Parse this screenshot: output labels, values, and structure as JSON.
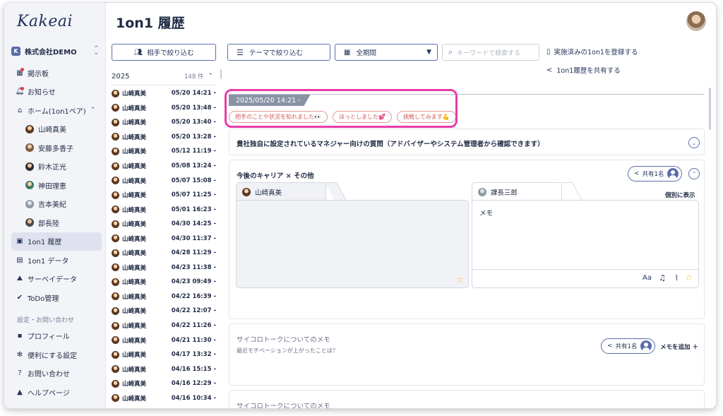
{
  "app": {
    "logo": "Kakeai",
    "company": "株式会社DEMO"
  },
  "sidebar": {
    "items": [
      {
        "label": "掲示板",
        "icon": "grid-icon"
      },
      {
        "label": "お知らせ",
        "icon": "bell-icon"
      },
      {
        "label": "ホーム(1on1ペア)",
        "icon": "home-icon",
        "caret": "⌃"
      }
    ],
    "members": [
      "山崎真美",
      "安藤多香子",
      "鈴木正光",
      "神田理恵",
      "吉本美紀",
      "部長陸"
    ],
    "items2": [
      {
        "label": "1on1 履歴",
        "icon": "history-icon",
        "active": true
      },
      {
        "label": "1on1 データ",
        "icon": "chart-icon"
      },
      {
        "label": "サーベイデータ",
        "icon": "survey-icon"
      },
      {
        "label": "ToDo管理",
        "icon": "check-icon"
      }
    ],
    "section_label": "設定・お問い合わせ",
    "items3": [
      {
        "label": "プロフィール",
        "icon": "profile-icon"
      },
      {
        "label": "便利にする設定",
        "icon": "gear-icon"
      },
      {
        "label": "お問い合わせ",
        "icon": "question-icon"
      },
      {
        "label": "ヘルプページ",
        "icon": "help-icon"
      }
    ]
  },
  "header": {
    "title": "1on1 履歴"
  },
  "toolbar": {
    "filter_person": "相手で絞り込む",
    "filter_theme": "テーマで絞り込む",
    "period": "全期間",
    "search_placeholder": "キーワードで検索する",
    "register": "実施済みの1on1を登録する",
    "share_history": "1on1履歴を共有する"
  },
  "list": {
    "year": "2025",
    "count": "148 件",
    "rows": [
      {
        "name": "山崎真美",
        "date": "05/20 14:21 -"
      },
      {
        "name": "山崎真美",
        "date": "05/20 13:48 -"
      },
      {
        "name": "山崎真美",
        "date": "05/20 13:40 -"
      },
      {
        "name": "山崎真美",
        "date": "05/20 13:28 -"
      },
      {
        "name": "山崎真美",
        "date": "05/12 11:19 -"
      },
      {
        "name": "山崎真美",
        "date": "05/08 13:24 -"
      },
      {
        "name": "山崎真美",
        "date": "05/07 15:08 -"
      },
      {
        "name": "山崎真美",
        "date": "05/07 11:25 -"
      },
      {
        "name": "山崎真美",
        "date": "05/01 16:23 -"
      },
      {
        "name": "山崎真美",
        "date": "04/30 14:25 -"
      },
      {
        "name": "山崎真美",
        "date": "04/30 11:37 -"
      },
      {
        "name": "山崎真美",
        "date": "04/28 11:29 -"
      },
      {
        "name": "山崎真美",
        "date": "04/23 11:38 -"
      },
      {
        "name": "山崎真美",
        "date": "04/23 09:49 -"
      },
      {
        "name": "山崎真美",
        "date": "04/22 16:39 -"
      },
      {
        "name": "山崎真美",
        "date": "04/22 12:07 -"
      },
      {
        "name": "山崎真美",
        "date": "04/22 11:26 -"
      },
      {
        "name": "山崎真美",
        "date": "04/21 11:30 -"
      },
      {
        "name": "山崎真美",
        "date": "04/17 13:32 -"
      },
      {
        "name": "山崎真美",
        "date": "04/16 15:15 -"
      },
      {
        "name": "山崎真美",
        "date": "04/16 12:29 -"
      },
      {
        "name": "山崎真美",
        "date": "04/16 10:34 -"
      }
    ]
  },
  "session": {
    "date": "2025/05/20 14:21 -",
    "chips": [
      "相手のことや状況を知れました👀",
      "ほっとしました💕",
      "挑戦してみます💪"
    ]
  },
  "cards": {
    "manager_question": "貴社独自に設定されているマネジャー向けの質問（アドバイザーやシステム管理者から確認できます）",
    "career": {
      "title": "今後のキャリア × その他",
      "share": "共有1名",
      "left_tab": "山崎真美",
      "right_tab": "課長三郎",
      "show_sep": "個別に表示",
      "memo": "メモ",
      "font_label": "Aa"
    },
    "dice1": {
      "title": "サイコロトークについてのメモ",
      "sub": "最近モチベーションが上がったことは？",
      "share": "共有1名",
      "add": "メモを追加 ＋"
    },
    "dice2": {
      "title": "サイコロトークについてのメモ"
    }
  },
  "colors": {
    "accent": "#5b6ea8",
    "highlight": "#e83ca8",
    "chip": "#d05a5a"
  }
}
